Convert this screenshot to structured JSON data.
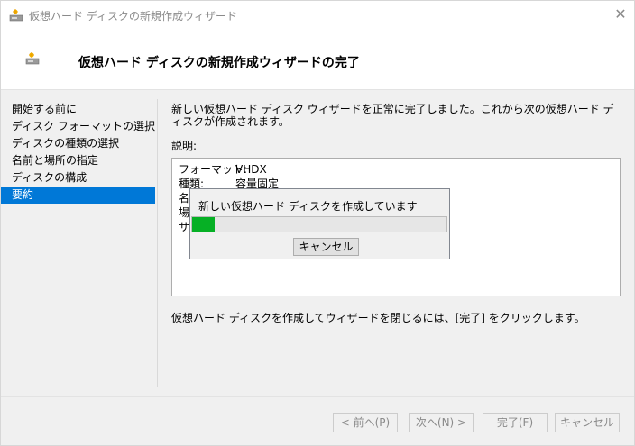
{
  "window": {
    "title": "仮想ハード ディスクの新規作成ウィザード",
    "close_glyph": "✕"
  },
  "header": {
    "title": "仮想ハード ディスクの新規作成ウィザードの完了"
  },
  "nav": {
    "items": [
      {
        "label": "開始する前に",
        "selected": false
      },
      {
        "label": "ディスク フォーマットの選択",
        "selected": false
      },
      {
        "label": "ディスクの種類の選択",
        "selected": false
      },
      {
        "label": "名前と場所の指定",
        "selected": false
      },
      {
        "label": "ディスクの構成",
        "selected": false
      },
      {
        "label": "要約",
        "selected": true
      }
    ]
  },
  "content": {
    "intro": "新しい仮想ハード ディスク ウィザードを正常に完了しました。これから次の仮想ハード ディスクが作成されます。",
    "description_label": "説明:",
    "summary": [
      {
        "key": "フォーマット:",
        "value": "VHDX"
      },
      {
        "key": "種類:",
        "value": "容量固定"
      },
      {
        "key": "名",
        "value": ""
      },
      {
        "key": "場",
        "value": ""
      },
      {
        "key": "サ",
        "value": ""
      }
    ],
    "footer": "仮想ハード ディスクを作成してウィザードを閉じるには、[完了] をクリックします。"
  },
  "progress_dialog": {
    "message": "新しい仮想ハード ディスクを作成しています",
    "progress_fraction": 0.09,
    "cancel_label": "キャンセル"
  },
  "buttons": {
    "back": "< 前へ(P)",
    "next": "次へ(N) >",
    "finish": "完了(F)",
    "cancel": "キャンセル"
  },
  "colors": {
    "accent": "#0078d7",
    "progress": "#06b025"
  },
  "icons": {
    "app": "disk-icon",
    "header": "disk-icon"
  }
}
